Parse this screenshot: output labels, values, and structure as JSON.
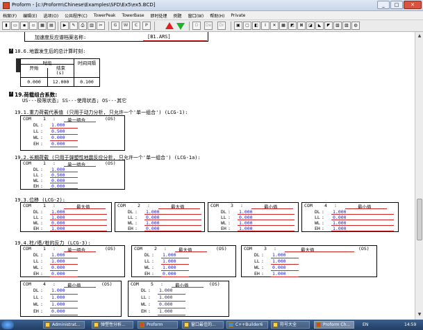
{
  "window": {
    "title": "Proform - [c:\\Proform\\Chinese\\Examples\\SFD\\Ex5\\ex5.BCD]",
    "buttons": [
      "_",
      "□",
      "✕"
    ]
  },
  "menu": [
    "档案(F)",
    "编辑(E)",
    "选项(O)",
    "公共程序(C)",
    "TowerPeak",
    "TowerBase",
    "即时处理",
    "例题",
    "窗口(W)",
    "帮助(H)",
    "Private"
  ],
  "toolbar": {
    "text_buttons": [
      "G",
      "W",
      "C",
      "P",
      "D",
      "De",
      "Dr"
    ]
  },
  "doc": {
    "top_field_label": "加速度反应谱档案名称:",
    "top_field_value": "[B1.ARS]",
    "s18_6_title": "18.6.地震发生后的总计算时刻:",
    "s18_6_table": {
      "h_period": "时段",
      "h_interval": "时间间隔",
      "h_start": "开始",
      "h_end": "结束",
      "h_unit": "(s)",
      "v_start": "0.000",
      "v_end": "12.000",
      "v_interval": "0.100"
    },
    "s19_title": "19.荷载组合系数:",
    "s19_legend": "US---极限状态;    SS---使用状态;    OS---其它",
    "s19_1_title": "19.1.重力荷载代表值 (只用于动力分析, 只允许一个'单一组合') (LCG-1):",
    "s19_2_title": "19.2.长期荷载 (只用于弹塑性地震反应分析, 只允许一个'单一组合') (LCG-1a):",
    "s19_3_title": "19.3.位移 (LCG-2):",
    "s19_4_title": "19.4.柱/墙/桩的反力 (LCG-3):",
    "lbl_com": "COM",
    "lbl_dl": "DL",
    "lbl_ll": "LL",
    "lbl_wl": "WL",
    "lbl_eh": "EH",
    "colon": ":",
    "combo_single": "单一组合",
    "combo_max": "最大值",
    "combo_min": "最小值",
    "os": "(OS)",
    "s19_1": {
      "num": "1",
      "dl": "1.000",
      "ll": "0.500",
      "wl": "0.000",
      "eh": "0.000"
    },
    "s19_2": {
      "num": "1",
      "dl": "1.000",
      "ll": "0.500",
      "wl": "0.000",
      "eh": "0.000"
    },
    "s19_3": [
      {
        "num": "1",
        "dl": "1.000",
        "ll": "1.000",
        "wl": "0.000",
        "eh": "1.000"
      },
      {
        "num": "2",
        "dl": "1.000",
        "ll": "0.000",
        "wl": "1.000",
        "eh": "0.000"
      },
      {
        "num": "3",
        "dl": "1.000",
        "ll": "0.000",
        "wl": "1.000",
        "eh": "1.000"
      },
      {
        "num": "4",
        "dl": "1.000",
        "ll": "0.000",
        "wl": "1.000",
        "eh": "1.000"
      }
    ],
    "s19_4": [
      {
        "num": "1",
        "dl": "1.000",
        "ll": "1.000",
        "wl": "0.000",
        "eh": "0.000"
      },
      {
        "num": "2",
        "dl": "1.000",
        "ll": "1.000",
        "wl": "1.000",
        "eh": "0.000"
      },
      {
        "num": "3",
        "dl": "1.000",
        "ll": "1.000",
        "wl": "0.000",
        "eh": "1.000"
      },
      {
        "num": "4",
        "dl": "1.000",
        "ll": "1.000",
        "wl": "1.000",
        "eh": "0.000"
      },
      {
        "num": "5",
        "dl": "1.000",
        "ll": "1.000",
        "wl": "0.000",
        "eh": "1.000"
      }
    ]
  },
  "taskbar": {
    "items": [
      "Administrat...",
      "弹塑性分析...",
      "Proform",
      "窗口最佳的...",
      "C++Builder6",
      "符号大全",
      "Proform Ch..."
    ],
    "tray_lang": "EN",
    "tray_time": "14:59"
  }
}
